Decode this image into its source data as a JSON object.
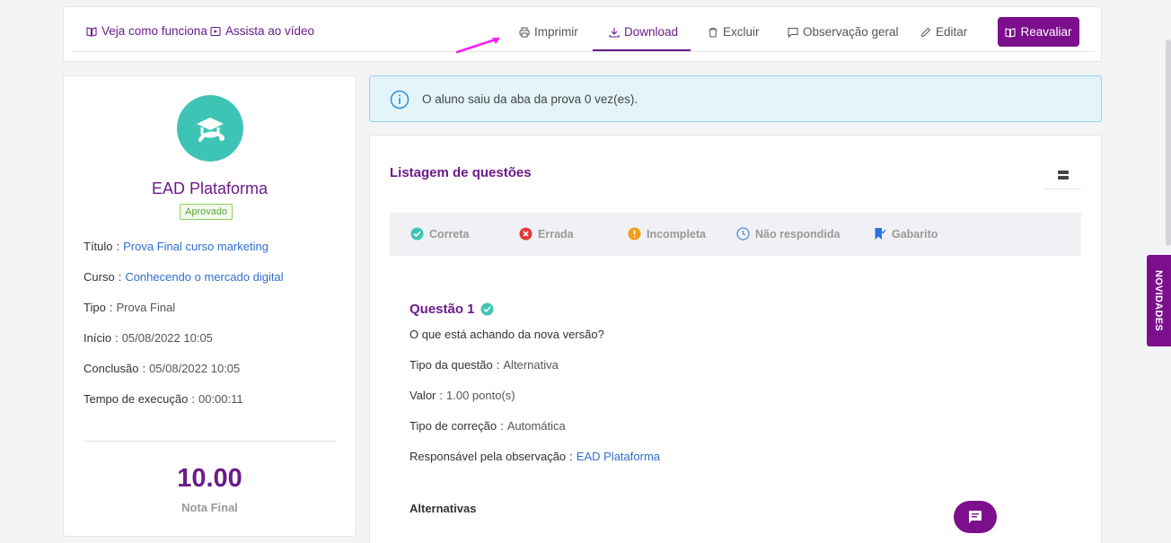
{
  "topbar": {
    "help_links": [
      {
        "label": "Veja como funciona",
        "icon": "book-icon"
      },
      {
        "label": "Assista ao vídeo",
        "icon": "play-icon"
      }
    ],
    "actions": [
      {
        "label": "Imprimir",
        "icon": "printer-icon"
      },
      {
        "label": "Download",
        "icon": "download-icon",
        "active": true
      },
      {
        "label": "Excluir",
        "icon": "trash-icon"
      },
      {
        "label": "Observação geral",
        "icon": "comment-icon"
      },
      {
        "label": "Editar",
        "icon": "pencil-icon"
      }
    ],
    "reavaliar_label": "Reavaliar"
  },
  "profile": {
    "name": "EAD Plataforma",
    "status": "Aprovado",
    "fields": [
      {
        "label": "Título",
        "value": "Prova Final curso marketing",
        "link": true
      },
      {
        "label": "Curso",
        "value": "Conhecendo o mercado digital",
        "link": true
      },
      {
        "label": "Tipo",
        "value": "Prova Final",
        "link": false
      },
      {
        "label": "Início",
        "value": "05/08/2022 10:05",
        "link": false
      },
      {
        "label": "Conclusão",
        "value": "05/08/2022 10:05",
        "link": false
      },
      {
        "label": "Tempo de execução",
        "value": "00:00:11",
        "link": false
      }
    ],
    "score": "10.00",
    "score_label": "Nota Final"
  },
  "alert": {
    "text": "O aluno saiu da aba da prova 0 vez(es)."
  },
  "questions": {
    "title": "Listagem de questões",
    "legend": [
      {
        "label": "Correta",
        "icon": "check-circle-icon",
        "color": "#3ec4b4"
      },
      {
        "label": "Errada",
        "icon": "x-circle-icon",
        "color": "#e53935"
      },
      {
        "label": "Incompleta",
        "icon": "warning-circle-icon",
        "color": "#f59c1a"
      },
      {
        "label": "Não respondida",
        "icon": "clock-icon",
        "color": "#4a90d9"
      },
      {
        "label": "Gabarito",
        "icon": "bookmark-icon",
        "color": "#2f6fe0"
      }
    ],
    "q1": {
      "title": "Questão 1",
      "text": "O que está achando da nova versão?",
      "fields": [
        {
          "label": "Tipo da questão",
          "value": "Alternativa",
          "link": false
        },
        {
          "label": "Valor",
          "value": "1.00 ponto(s)",
          "link": false
        },
        {
          "label": "Tipo de correção",
          "value": "Automática",
          "link": false
        },
        {
          "label": "Responsável pela observação",
          "value": "EAD Plataforma",
          "link": true
        }
      ],
      "alternatives_label": "Alternativas"
    }
  },
  "side_tab": {
    "label": "NOVIDADES"
  },
  "colors": {
    "brand": "#7b0f8c",
    "accent_teal": "#3ec4b4",
    "link": "#2f6fcf"
  }
}
